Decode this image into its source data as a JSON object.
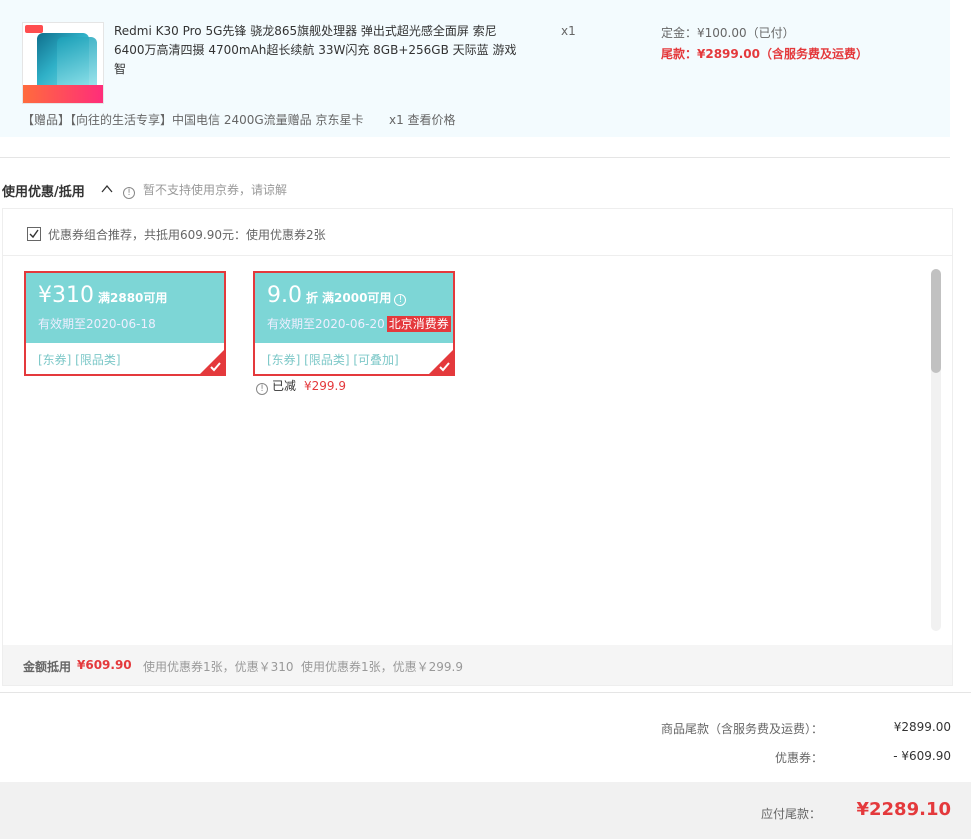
{
  "product": {
    "title": "Redmi K30 Pro 5G先锋 骁龙865旗舰处理器 弹出式超光感全面屏 索尼6400万高清四摄 4700mAh超长续航 33W闪充 8GB+256GB 天际蓝 游戏智",
    "quantity": "x1",
    "deposit": "定金：¥100.00（已付）",
    "balance": "尾款：¥2899.00（含服务费及运费）"
  },
  "gift": {
    "text": "【赠品】【向往的生活专享】中国电信 2400G流量赠品 京东星卡",
    "quantity": "x1 查看价格"
  },
  "discount": {
    "title": "使用优惠/抵用",
    "notice": "暂不支持使用京券，请谅解",
    "combo_text": "优惠券组合推荐，共抵用609.90元：使用优惠券2张",
    "coupons": [
      {
        "amount": "¥310",
        "condition": "满2880可用",
        "expire": "有效期至2020-06-18",
        "tags": "[东券]  [限品类]",
        "selected": true
      },
      {
        "amount": "9.0",
        "unit": "折",
        "condition": "满2000可用",
        "expire": "有效期至2020-06-20",
        "city_tag": "北京消费券",
        "tags": "[东券]  [限品类]  [可叠加]",
        "selected": true
      }
    ],
    "reduced_label": "已减",
    "reduced_amount": "¥299.9",
    "summary_label": "金额抵用",
    "summary_amount": "¥609.90",
    "summary_detail_1": "使用优惠券1张，优惠￥310",
    "summary_detail_2": "使用优惠券1张，优惠￥299.9"
  },
  "totals": {
    "balance_label": "商品尾款（含服务费及运费）：",
    "balance_value": "¥2899.00",
    "coupon_label": "优惠券：",
    "coupon_value": "- ¥609.90",
    "pay_label": "应付尾款：",
    "pay_value": "¥2289.10"
  },
  "colors": {
    "accent_red": "#e4393c",
    "coupon_teal": "#7dd6d6",
    "panel_bg": "#f3fbfe"
  }
}
